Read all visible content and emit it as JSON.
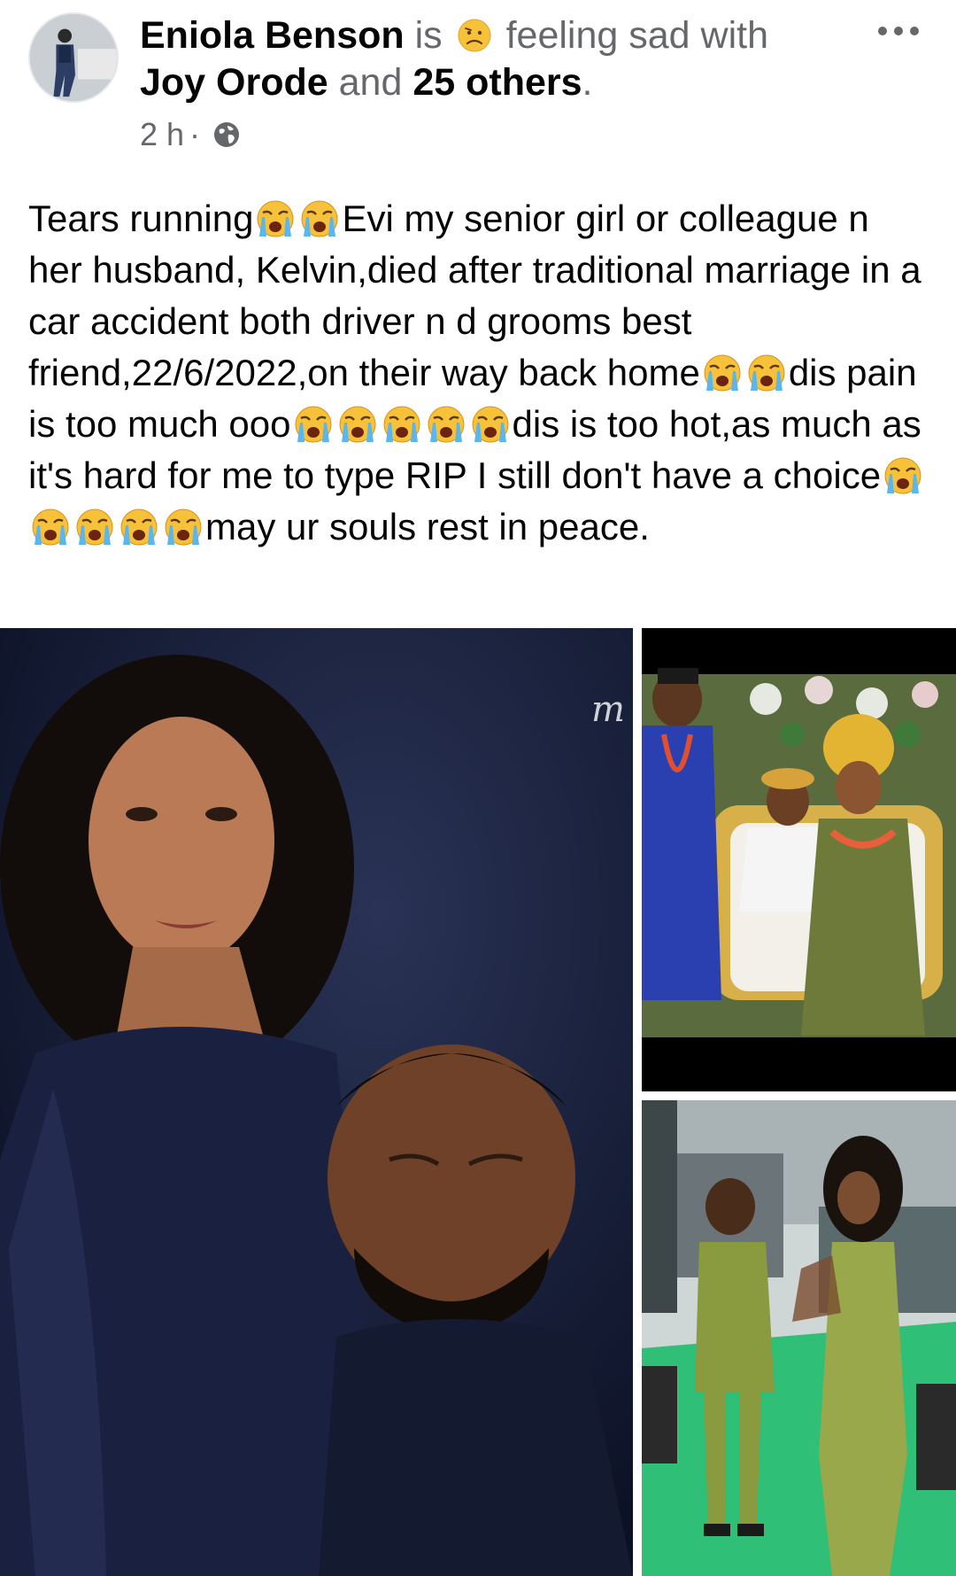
{
  "post": {
    "author": "Eniola Benson",
    "connector_is": "is",
    "feeling": "feeling sad with",
    "tagged_first": "Joy Orode",
    "connector_and": "and",
    "tagged_others": "25 others",
    "period": ".",
    "time": "2 h",
    "dot": "·",
    "privacy_icon": "globe-icon",
    "more_icon": "more-options-icon",
    "feeling_icon": "sad-face-emoji",
    "body_segments": [
      "Tears running",
      "Evi my senior girl or colleague n her husband, Kelvin,died after traditional marriage in a car accident both driver n d grooms best friend,22/6/2022,on their  way back home",
      "dis pain is too much ooo",
      "dis is too hot,as much as it's hard for me to type RIP I still don't have a choice",
      "may ur souls rest in peace."
    ],
    "body_emoji_icon": "loudly-crying-face-emoji"
  },
  "colors": {
    "name_text": "#050505",
    "meta_text": "#65676b",
    "background": "#ffffff"
  },
  "photos": [
    {
      "name": "couple-portrait-photo"
    },
    {
      "name": "traditional-wedding-photo"
    },
    {
      "name": "couple-outdoor-photo"
    }
  ]
}
